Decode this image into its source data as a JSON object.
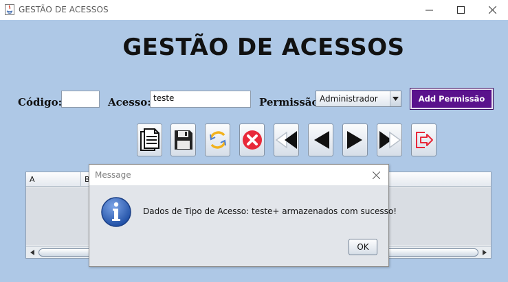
{
  "window": {
    "title": "GESTÃO DE ACESSOS",
    "controls": [
      "minimize-icon",
      "maximize-icon",
      "close-icon"
    ]
  },
  "header": {
    "title": "GESTÃO DE ACESSOS"
  },
  "form": {
    "codigo_label": "Código:",
    "codigo_value": "",
    "acesso_label": "Acesso:",
    "acesso_value": "teste",
    "permissao_label": "Permissão:",
    "permissao_selected": "Administrador",
    "add_button_label": "Add Permissão"
  },
  "toolbar": {
    "buttons": [
      {
        "name": "new-document-icon"
      },
      {
        "name": "save-icon"
      },
      {
        "name": "refresh-icon"
      },
      {
        "name": "delete-icon"
      },
      {
        "name": "first-record-icon"
      },
      {
        "name": "previous-record-icon"
      },
      {
        "name": "next-record-icon"
      },
      {
        "name": "last-record-icon"
      },
      {
        "name": "exit-icon"
      }
    ]
  },
  "table": {
    "columns": [
      "A",
      "B"
    ]
  },
  "dialog": {
    "title": "Message",
    "message": "Dados de Tipo de Acesso: teste+ armazenados com sucesso!",
    "ok_label": "OK",
    "icon": "information-icon"
  },
  "colors": {
    "background": "#aec8e6",
    "accent_button": "#5a128c",
    "delete_red": "#e8293a",
    "info_blue": "#2f62b8"
  }
}
